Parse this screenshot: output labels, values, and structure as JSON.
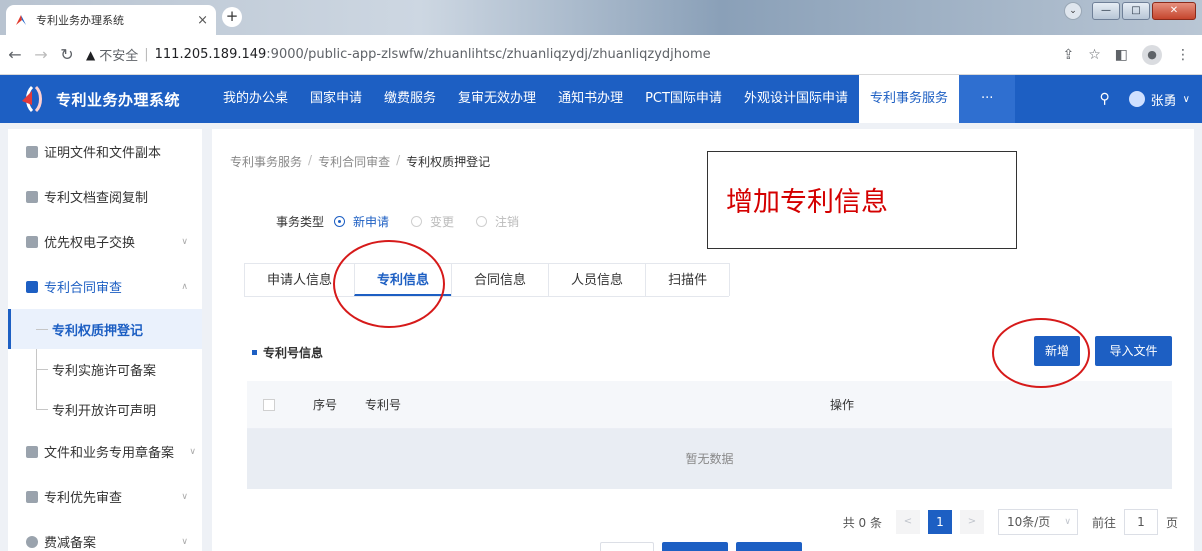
{
  "browser": {
    "tab_title": "专利业务办理系统",
    "tab_close": "×",
    "new_tab": "+",
    "warn_icon": "▲",
    "insecure_label": "不安全",
    "url_sep": "|",
    "url_host": "111.205.189.149",
    "url_path": ":9000/public-app-zlswfw/zhuanlihtsc/zhuanliqzydj/zhuanliqzydjhome"
  },
  "app": {
    "name": "专利业务办理系统",
    "nav": [
      "我的办公桌",
      "国家申请",
      "缴费服务",
      "复审无效办理",
      "通知书办理",
      "PCT国际申请",
      "外观设计国际申请",
      "专利事务服务"
    ],
    "more": "···",
    "user_name": "张勇"
  },
  "sidebar": {
    "items": [
      {
        "label": "证明文件和文件副本"
      },
      {
        "label": "专利文档查阅复制"
      },
      {
        "label": "优先权电子交换"
      },
      {
        "label": "专利合同审查"
      },
      {
        "label": "文件和业务专用章备案"
      },
      {
        "label": "专利优先审查"
      },
      {
        "label": "费减备案"
      }
    ],
    "sub_items": [
      "专利权质押登记",
      "专利实施许可备案",
      "专利开放许可声明"
    ]
  },
  "main": {
    "breadcrumb": [
      "专利事务服务",
      "专利合同审查",
      "专利权质押登记"
    ],
    "bc_sep": "/",
    "annotation": "增加专利信息",
    "type_label": "事务类型",
    "type_options": [
      "新申请",
      "变更",
      "注销"
    ],
    "tabs": [
      "申请人信息",
      "专利信息",
      "合同信息",
      "人员信息",
      "扫描件"
    ],
    "section_title": "专利号信息",
    "add_button": "新增",
    "import_button": "导入文件",
    "table_headers": [
      "序号",
      "专利号",
      "操作"
    ],
    "empty_text": "暂无数据",
    "pager": {
      "total": "共 0 条",
      "prev": "<",
      "page": "1",
      "next": ">",
      "size": "10条/页",
      "goto_prefix": "前往",
      "goto_value": "1",
      "goto_suffix": "页"
    }
  },
  "colors": {
    "primary": "#1d5fc3",
    "annotation_red": "#d40000"
  }
}
